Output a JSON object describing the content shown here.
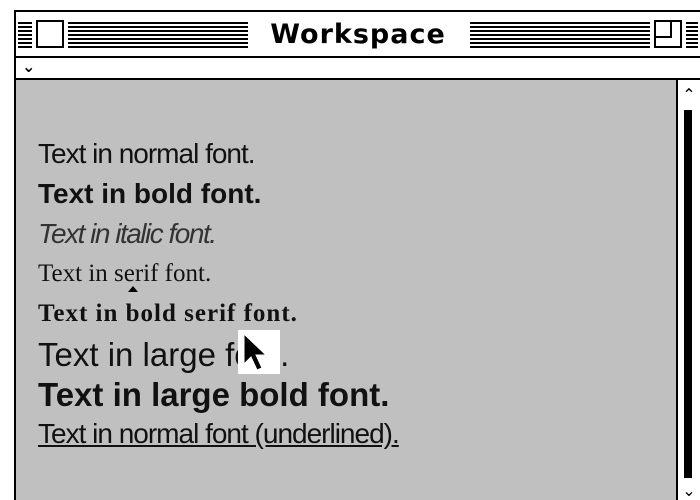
{
  "window": {
    "title": "Workspace"
  },
  "menu_strip": {
    "chevron": "⌄"
  },
  "content": {
    "lines": [
      "Text in normal font.",
      "Text in bold font.",
      "Text in italic font.",
      "Text in serif font.",
      "Text in bold serif font.",
      "Text in large font.",
      "Text in large bold font.",
      "Text in normal font (underlined)."
    ],
    "background_color": "#c0c0c0"
  },
  "scrollbar": {
    "up_arrow": "⌃",
    "down_arrow": "⌄"
  },
  "icons": {
    "close": "close-box-icon",
    "zoom": "zoom-box-icon",
    "pointer": "arrow-pointer-icon",
    "text_insertion": "text-caret-icon"
  }
}
